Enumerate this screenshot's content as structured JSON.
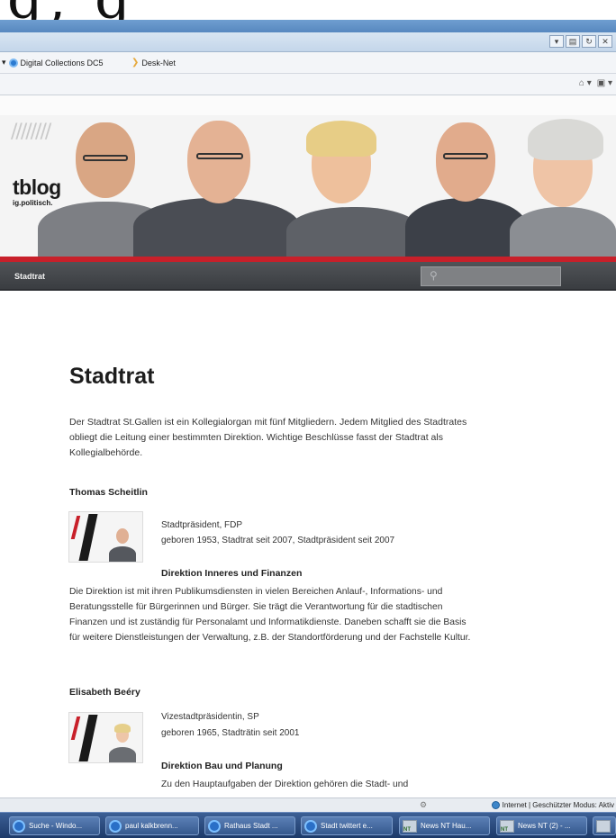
{
  "browser": {
    "favorites": [
      {
        "label": "Digital Collections DC5"
      },
      {
        "label": "Desk-Net"
      }
    ]
  },
  "banner": {
    "blog_title": "tblog",
    "blog_subtitle": "ig.politisch."
  },
  "nav": {
    "item": "Stadtrat",
    "search_placeholder": ""
  },
  "page": {
    "title": "Stadtrat",
    "intro": "Der Stadtrat St.Gallen ist ein Kollegialorgan mit fünf Mitgliedern. Jedem Mitglied des Stadtrates obliegt die Leitung einer bestimmten Direktion. Wichtige Beschlüsse fasst der Stadtrat als Kollegialbehörde.",
    "members": [
      {
        "name": "Thomas Scheitlin",
        "role": "Stadtpräsident, FDP",
        "born": "geboren 1953, Stadtrat seit 2007, Stadtpräsident seit 2007",
        "department": "Direktion Inneres und Finanzen",
        "department_text": "Die Direktion ist mit ihren Publikumsdiensten in vielen Bereichen Anlauf-, Informations- und Beratungsstelle für Bürgerinnen und Bürger. Sie trägt die Verantwortung für die stadtischen Finanzen und ist zuständig für Personalamt und Informatikdienste. Daneben schafft sie die Basis für weitere Dienstleistungen der Verwaltung, z.B. der Standortförderung und der Fachstelle Kultur."
      },
      {
        "name": "Elisabeth Beéry",
        "role": "Vizestadtpräsidentin, SP",
        "born": "geboren 1965, Stadträtin seit 2001",
        "department": "Direktion Bau und Planung",
        "department_text": "Zu den Hauptaufgaben der Direktion gehören die Stadt- und"
      }
    ]
  },
  "statusbar": {
    "zone": "Internet | Geschützter Modus: Aktiv"
  },
  "taskbar": {
    "tasks": [
      {
        "label": "Suche - Windo...",
        "icon": "ie-icon"
      },
      {
        "label": "paul kalkbrenn...",
        "icon": "ie-icon"
      },
      {
        "label": "Rathaus Stadt ...",
        "icon": "ie-icon"
      },
      {
        "label": "Stadt twittert e...",
        "icon": "ie-icon"
      },
      {
        "label": "News NT Hau...",
        "icon": "nt-icon"
      },
      {
        "label": "News NT (2) - ...",
        "icon": "nt-icon"
      }
    ]
  }
}
